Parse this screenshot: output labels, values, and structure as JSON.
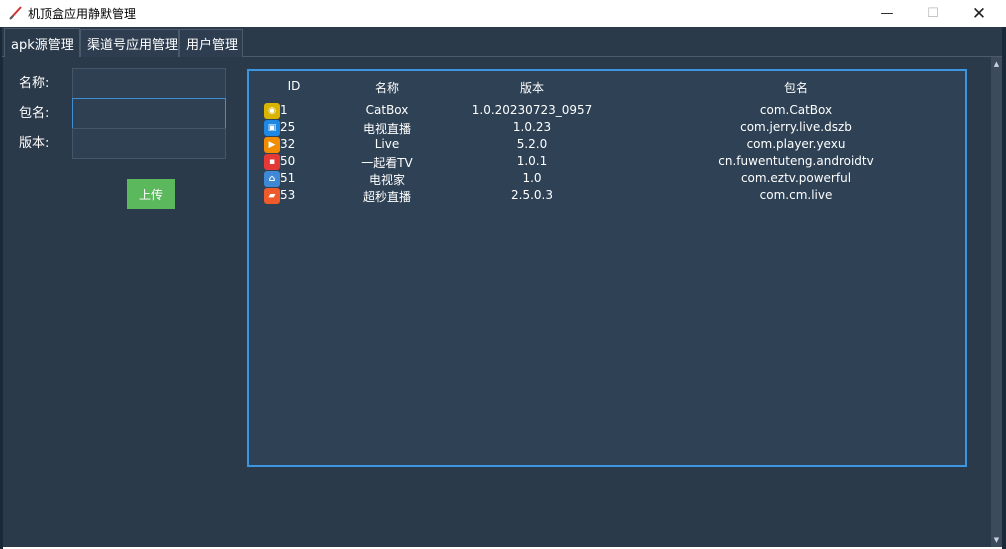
{
  "window": {
    "title": "机顶盒应用静默管理",
    "minimize_glyph": "—",
    "maximize_glyph": "☐",
    "close_glyph": "✕"
  },
  "tabs": [
    {
      "label": "apk源管理",
      "active": true
    },
    {
      "label": "渠道号应用管理",
      "active": false
    },
    {
      "label": "用户管理",
      "active": false
    }
  ],
  "form": {
    "name_label": "名称:",
    "name_value": "",
    "package_label": "包名:",
    "package_value": "",
    "version_label": "版本:",
    "version_value": "",
    "upload_label": "上传"
  },
  "table": {
    "headers": {
      "id": "ID",
      "name": "名称",
      "version": "版本",
      "package": "包名"
    },
    "rows": [
      {
        "id": "1",
        "name": "CatBox",
        "version": "1.0.20230723_0957",
        "package": "com.CatBox",
        "icon": "catbox-app-icon",
        "icon_color": "#d9b400",
        "icon_glyph": "◉"
      },
      {
        "id": "25",
        "name": "电视直播",
        "version": "1.0.23",
        "package": "com.jerry.live.dszb",
        "icon": "tv-app-icon",
        "icon_color": "#1e88e5",
        "icon_glyph": "▣"
      },
      {
        "id": "32",
        "name": "Live",
        "version": "5.2.0",
        "package": "com.player.yexu",
        "icon": "play-app-icon",
        "icon_color": "#f28c00",
        "icon_glyph": "▶"
      },
      {
        "id": "50",
        "name": "一起看TV",
        "version": "1.0.1",
        "package": "cn.fuwentuteng.androidtv",
        "icon": "watch-tv-app-icon",
        "icon_color": "#e53935",
        "icon_glyph": "▪"
      },
      {
        "id": "51",
        "name": "电视家",
        "version": "1.0",
        "package": "com.eztv.powerful",
        "icon": "tv-home-app-icon",
        "icon_color": "#3f88d6",
        "icon_glyph": "⌂"
      },
      {
        "id": "53",
        "name": "超秒直播",
        "version": "2.5.0.3",
        "package": "com.cm.live",
        "icon": "live-app-icon",
        "icon_color": "#ef5a2a",
        "icon_glyph": "▰"
      }
    ]
  },
  "colors": {
    "background": "#2b3a4a",
    "panel_border": "#3d95e0",
    "upload_button": "#5cb85c"
  }
}
